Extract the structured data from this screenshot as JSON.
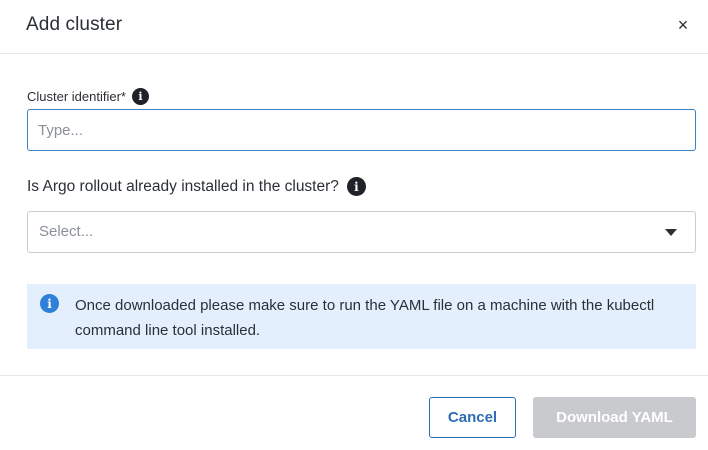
{
  "dialog": {
    "title": "Add cluster",
    "close_glyph": "×"
  },
  "cluster_identifier": {
    "label": "Cluster identifier*",
    "info_icon": "info-circle-icon",
    "placeholder": "Type...",
    "value": ""
  },
  "argo_rollout": {
    "label": "Is Argo rollout already installed in the cluster?",
    "info_icon": "info-circle-icon",
    "selected": "Select...",
    "dropdown_icon": "caret-down-icon"
  },
  "notice": {
    "icon": "info-circle-icon",
    "text": "Once downloaded please make sure to run the YAML file on a machine with the kubectl command line tool installed.",
    "background": "#e3effc",
    "icon_color": "#2f80d9"
  },
  "footer": {
    "cancel_label": "Cancel",
    "download_label": "Download YAML",
    "primary_color": "#2d6db5",
    "disabled_color": "#c8cacd"
  }
}
